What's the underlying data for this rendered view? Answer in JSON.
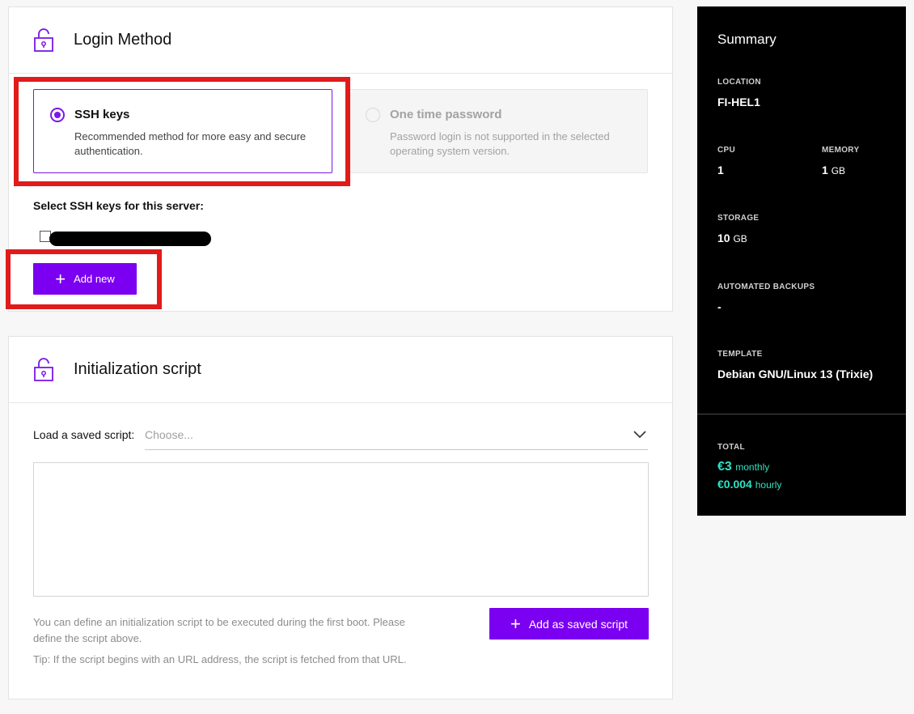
{
  "login": {
    "title": "Login Method",
    "ssh": {
      "title": "SSH keys",
      "desc": "Recommended method for more easy and secure authentication."
    },
    "otp": {
      "title": "One time password",
      "desc": "Password login is not supported in the selected operating system version."
    },
    "ssh_select_label": "Select SSH keys for this server:",
    "add_new": "Add new"
  },
  "init": {
    "title": "Initialization script",
    "load_label": "Load a saved script:",
    "select_placeholder": "Choose...",
    "help_text": "You can define an initialization script to be executed during the first boot. Please define the script above.",
    "tip_text": "Tip: If the script begins with an URL address, the script is fetched from that URL.",
    "add_saved": "Add as saved script"
  },
  "summary": {
    "title": "Summary",
    "location_label": "LOCATION",
    "location": "FI-HEL1",
    "cpu_label": "CPU",
    "cpu": "1",
    "memory_label": "MEMORY",
    "memory": "1",
    "memory_unit": "GB",
    "storage_label": "STORAGE",
    "storage": "10",
    "storage_unit": "GB",
    "backups_label": "AUTOMATED BACKUPS",
    "backups": "-",
    "template_label": "TEMPLATE",
    "template": "Debian GNU/Linux 13 (Trixie)",
    "total_label": "TOTAL",
    "monthly_price": "€3",
    "monthly_unit": "monthly",
    "hourly_price": "€0.004",
    "hourly_unit": "hourly"
  },
  "colors": {
    "accent": "#7b00f2",
    "highlight": "#e11b1b",
    "price": "#2de2c1",
    "summary_bg": "#000000"
  },
  "icons": {
    "login": "lock-open-icon",
    "init": "lock-open-icon",
    "add": "plus-icon",
    "select": "chevron-down-icon"
  }
}
